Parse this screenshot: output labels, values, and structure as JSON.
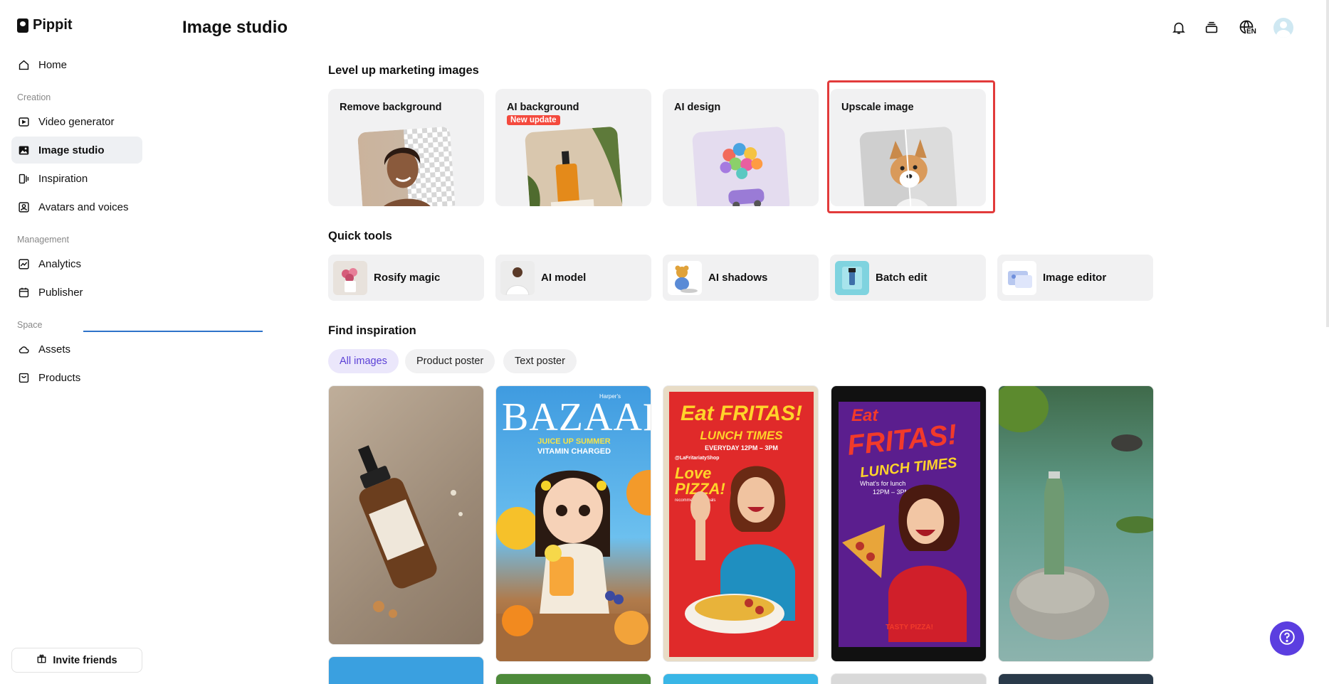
{
  "app": {
    "name": "Pippit"
  },
  "sidebar": {
    "home": "Home",
    "creation_label": "Creation",
    "creation_items": [
      "Video generator",
      "Image studio",
      "Inspiration",
      "Avatars and voices"
    ],
    "management_label": "Management",
    "management_items": [
      "Analytics",
      "Publisher"
    ],
    "space_label": "Space",
    "space_items": [
      "Assets",
      "Products"
    ],
    "invite": "Invite friends"
  },
  "header": {
    "title": "Image studio",
    "language": "EN"
  },
  "marketing": {
    "heading": "Level up marketing images",
    "cards": [
      {
        "title": "Remove background",
        "badge": ""
      },
      {
        "title": "AI background",
        "badge": "New update"
      },
      {
        "title": "AI design",
        "badge": ""
      },
      {
        "title": "Upscale image",
        "badge": ""
      }
    ]
  },
  "quick_tools": {
    "heading": "Quick tools",
    "items": [
      "Rosify magic",
      "AI model",
      "AI shadows",
      "Batch edit",
      "Image editor"
    ]
  },
  "inspiration": {
    "heading": "Find inspiration",
    "filters": [
      "All images",
      "Product poster",
      "Text poster"
    ],
    "posters": {
      "bazaar_brand": "BAZAAR",
      "bazaar_tag": "Harper's",
      "bazaar_line1": "JUICE UP SUMMER",
      "bazaar_line2": "VITAMIN CHARGED",
      "fritas1_title": "Eat FRITAS!",
      "fritas1_sub": "LUNCH TIMES",
      "fritas1_hours": "EVERYDAY 12PM – 3PM",
      "fritas1_handle": "@LaFritariatyShop",
      "fritas1_love": "Love",
      "fritas1_pizza": "PIZZA!",
      "fritas1_rec": "recommending meals",
      "fritas2_eat": "Eat",
      "fritas2_title": "FRITAS!",
      "fritas2_sub": "LUNCH TIMES",
      "fritas2_q1": "What's for lunch",
      "fritas2_q2": "12PM – 3PM",
      "fritas2_footer": "TASTY PIZZA!"
    }
  },
  "colors": {
    "accent": "#5b3ee0",
    "highlight": "#e23b3b",
    "badge": "#f44a3e",
    "active_nav": "#eef0f3"
  }
}
